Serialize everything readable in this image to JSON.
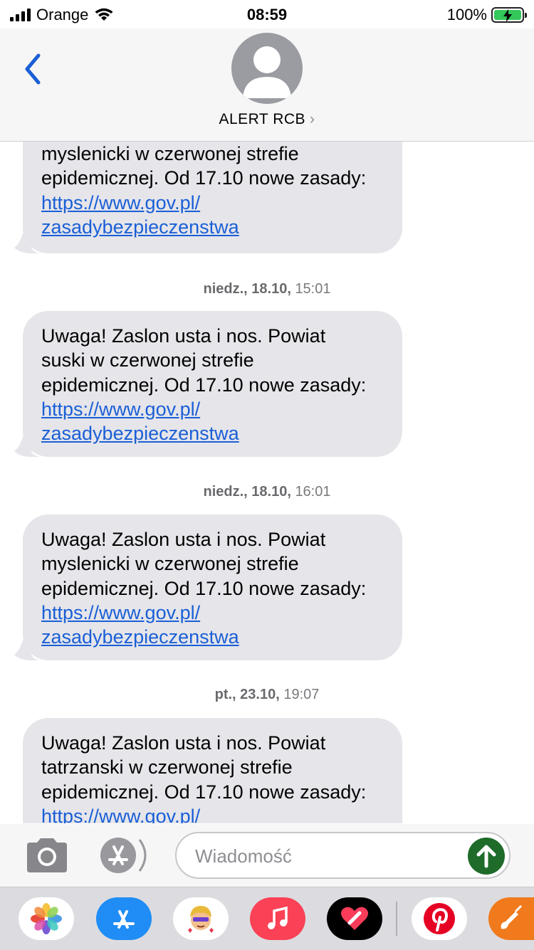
{
  "status_bar": {
    "carrier": "Orange",
    "time": "08:59",
    "battery": "100%"
  },
  "header": {
    "contact_name": "ALERT RCB",
    "chevron": "›"
  },
  "messages": [
    {
      "line1": "myslenicki w czerwonej strefie",
      "line2": "epidemicznej. Od 17.10 nowe zasady:",
      "link1": "https://www.gov.pl/",
      "link2": "zasadybezpieczenstwa"
    },
    {
      "line0": "Uwaga! Zaslon usta i nos. Powiat",
      "line1": "suski w czerwonej strefie",
      "line2": "epidemicznej. Od 17.10 nowe zasady:",
      "link1": "https://www.gov.pl/",
      "link2": "zasadybezpieczenstwa"
    },
    {
      "line0": "Uwaga! Zaslon usta i nos. Powiat",
      "line1": "myslenicki w czerwonej strefie",
      "line2": "epidemicznej. Od 17.10 nowe zasady:",
      "link1": "https://www.gov.pl/",
      "link2": "zasadybezpieczenstwa"
    },
    {
      "line0": "Uwaga! Zaslon usta i nos. Powiat",
      "line1": "tatrzanski w czerwonej strefie",
      "line2": "epidemicznej. Od 17.10 nowe zasady:",
      "link1": "https://www.gov.pl/"
    }
  ],
  "timestamps": [
    {
      "day": "niedz., 18.10,",
      "time": "15:01"
    },
    {
      "day": "niedz., 18.10,",
      "time": "16:01"
    },
    {
      "day": "pt., 23.10,",
      "time": "19:07"
    }
  ],
  "compose": {
    "placeholder": "Wiadomość"
  },
  "app_drawer": [
    "photos-icon",
    "app-store-icon",
    "memoji-icon",
    "music-icon",
    "fitness-heart-icon",
    "pinterest-icon",
    "garageband-icon"
  ],
  "colors": {
    "bubble": "#e5e5ea",
    "link": "#1a5fd6",
    "nav_back": "#1a5fd6",
    "send": "#1e6b2a"
  }
}
